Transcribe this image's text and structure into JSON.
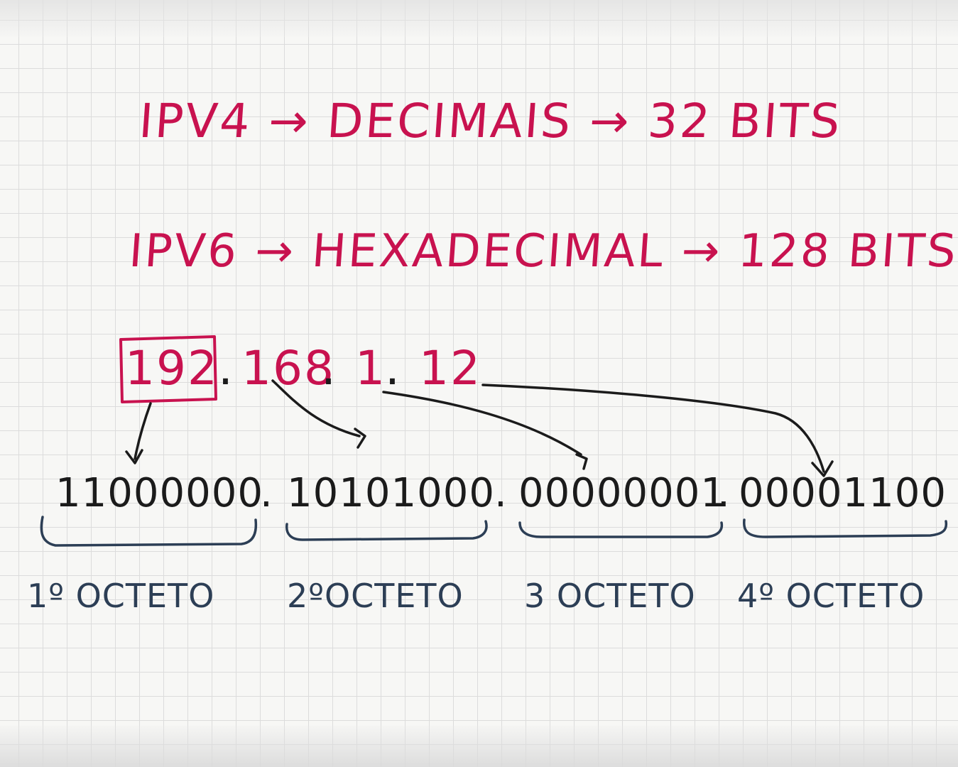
{
  "lines": {
    "ipv4": "IPV4 → DECIMAIS →  32 BITS",
    "ipv6": "IPV6 → HEXADECIMAL → 128 BITS"
  },
  "ip": {
    "octet1": "192",
    "octet2": "168",
    "octet3": "1",
    "octet4": "12",
    "dot": "."
  },
  "binary": {
    "octet1": "11000000",
    "octet2": "10101000",
    "octet3": "00000001",
    "octet4": "00001100",
    "dot": "."
  },
  "labels": {
    "octet1": "1º OCTETO",
    "octet2": "2ºOCTETO",
    "octet3": "3 OCTETO",
    "octet4": "4º OCTETO"
  },
  "colors": {
    "pink": "#c8124f",
    "ink": "#1b1b1b",
    "navy": "#2c3e55"
  }
}
